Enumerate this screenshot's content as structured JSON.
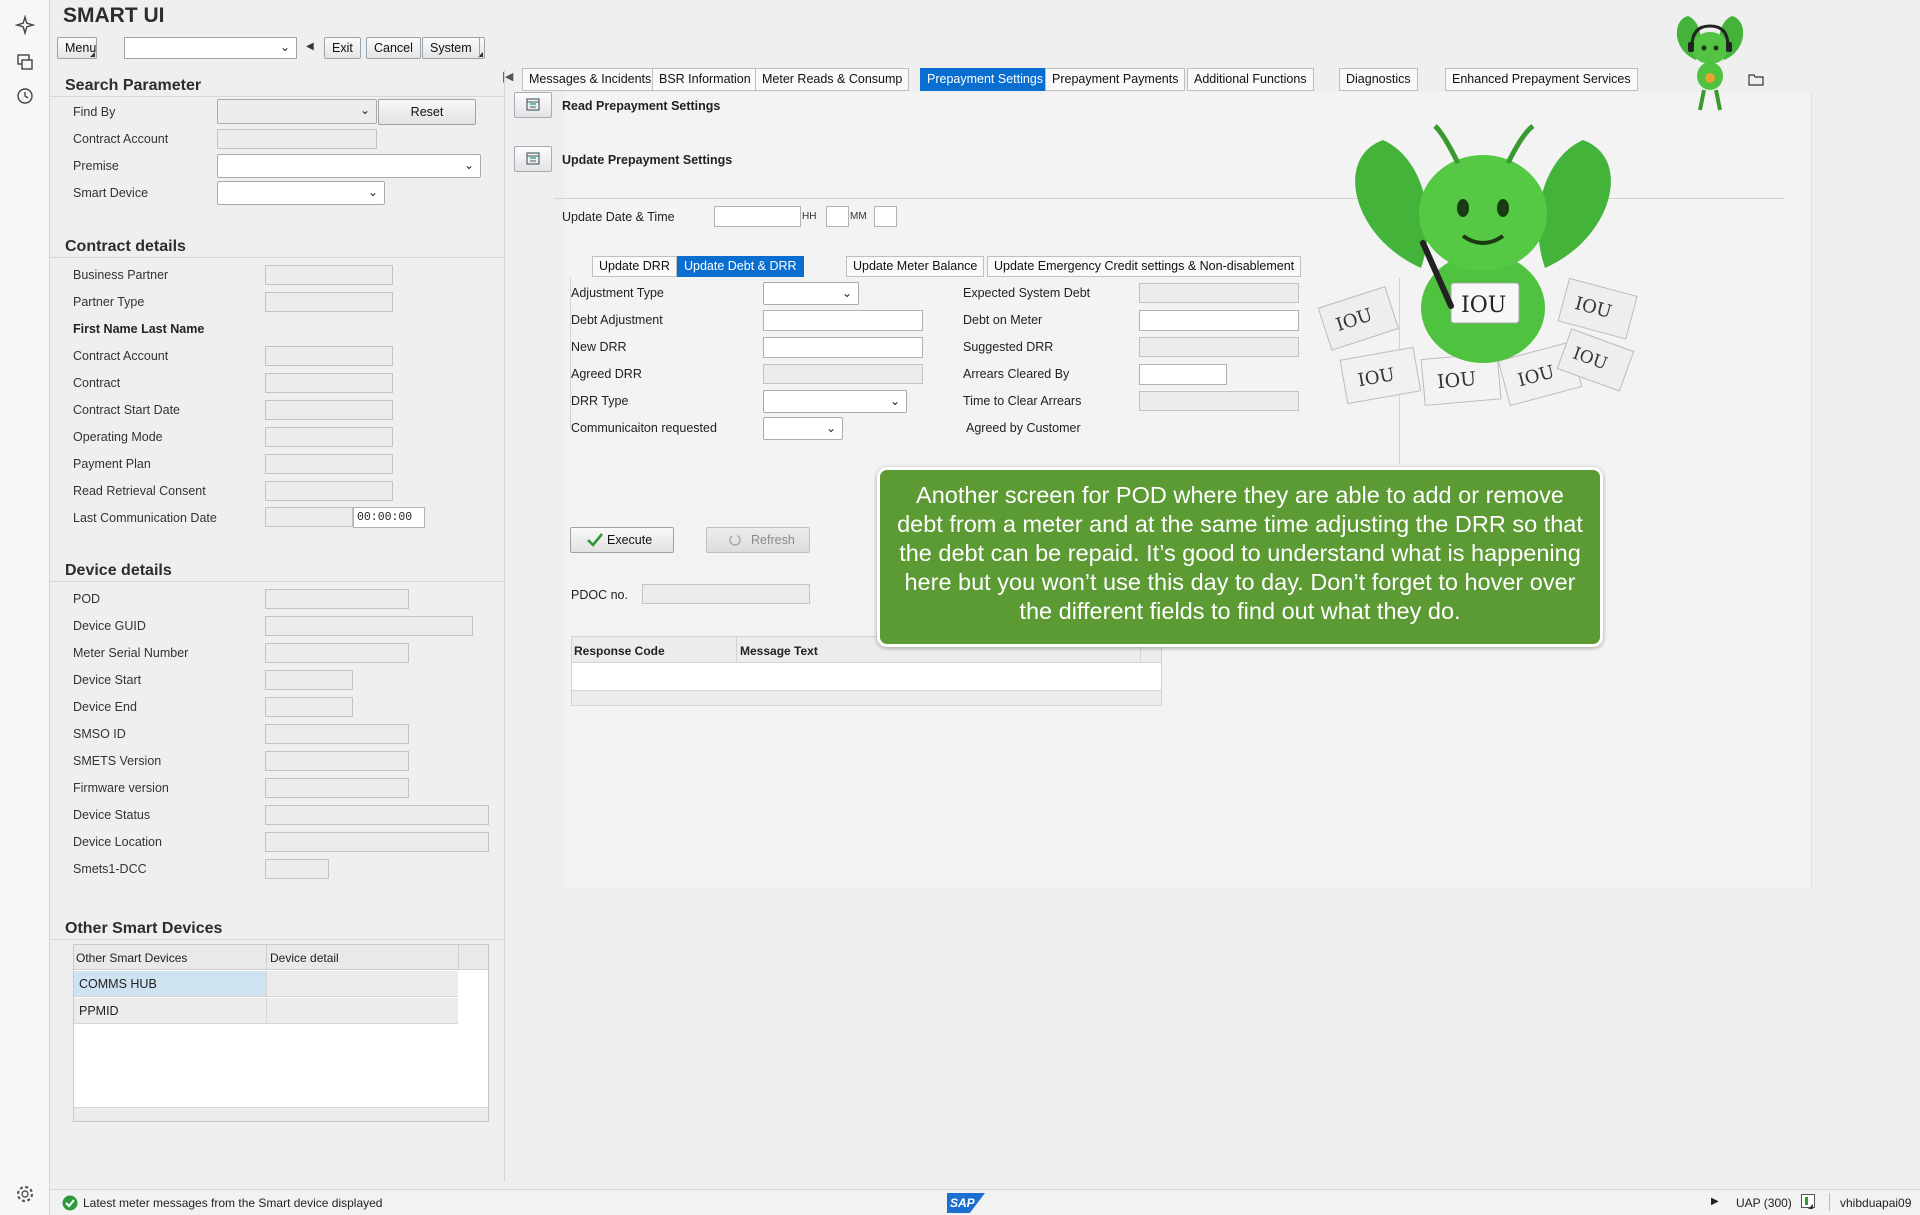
{
  "app": {
    "title": "SMART UI"
  },
  "toolbar": {
    "menu": "Menu",
    "exit": "Exit",
    "cancel": "Cancel",
    "system": "System"
  },
  "search": {
    "title": "Search Parameter",
    "find_by": "Find By",
    "reset": "Reset",
    "contract_account": "Contract Account",
    "premise": "Premise",
    "smart_device": "Smart Device"
  },
  "contract": {
    "title": "Contract details",
    "business_partner": "Business Partner",
    "partner_type": "Partner Type",
    "name": "First Name Last Name",
    "contract_account": "Contract Account",
    "contract": "Contract",
    "start_date": "Contract Start Date",
    "operating_mode": "Operating Mode",
    "payment_plan": "Payment Plan",
    "read_consent": "Read Retrieval Consent",
    "last_comm": "Last Communication Date",
    "last_comm_time": "00:00:00"
  },
  "device": {
    "title": "Device details",
    "pod": "POD",
    "guid": "Device GUID",
    "meter_serial": "Meter Serial Number",
    "start": "Device Start",
    "end": "Device End",
    "smso": "SMSO ID",
    "smets": "SMETS Version",
    "firmware": "Firmware version",
    "status": "Device Status",
    "location": "Device Location",
    "dcc": "Smets1-DCC"
  },
  "other": {
    "title": "Other Smart Devices",
    "col1": "Other Smart Devices",
    "col2": "Device detail",
    "rows": [
      "COMMS HUB",
      "PPMID"
    ]
  },
  "tabs": [
    "Messages & Incidents",
    "BSR Information",
    "Meter Reads & Consump",
    "Prepayment Settings",
    "Prepayment Payments",
    "Additional Functions",
    "Diagnostics",
    "Enhanced Prepayment Services"
  ],
  "active_tab": "Prepayment Settings",
  "prepay": {
    "read": "Read Prepayment Settings",
    "update": "Update Prepayment Settings",
    "update_dt": "Update Date & Time",
    "hh": "HH",
    "mm": "MM"
  },
  "subtabs": [
    "Update DRR",
    "Update Debt & DRR",
    "Update Meter Balance",
    "Update Emergency Credit settings & Non-disablement"
  ],
  "active_subtab": "Update Debt & DRR",
  "debt": {
    "adj_type": "Adjustment Type",
    "debt_adj": "Debt Adjustment",
    "new_drr": "New DRR",
    "agreed_drr": "Agreed DRR",
    "drr_type": "DRR Type",
    "comm_req": "Communicaiton requested",
    "exp_debt": "Expected System Debt",
    "debt_meter": "Debt on Meter",
    "sugg_drr": "Suggested DRR",
    "arrears_by": "Arrears Cleared By",
    "time_clear": "Time to Clear Arrears",
    "agreed_cust": "Agreed by Customer",
    "execute": "Execute",
    "refresh": "Refresh",
    "pdoc": "PDOC no.",
    "resp_code": "Response Code",
    "msg_text": "Message Text"
  },
  "toast": "Another screen for POD where they are able to add or remove debt from a meter and at the same time adjusting the DRR so that the debt can be repaid. It’s good to understand what is happening here but you won’t use this day to day. Don’t forget to hover over the different fields to find out what they do.",
  "mascot_text": "IOU",
  "status": {
    "message": "Latest meter messages from the Smart device displayed",
    "brand": "SAP",
    "system": "UAP (300)",
    "user": "vhibduapai09"
  },
  "colors": {
    "accent": "#0a6ed1",
    "toast": "#5c9a34",
    "success": "#2e9b3a"
  }
}
